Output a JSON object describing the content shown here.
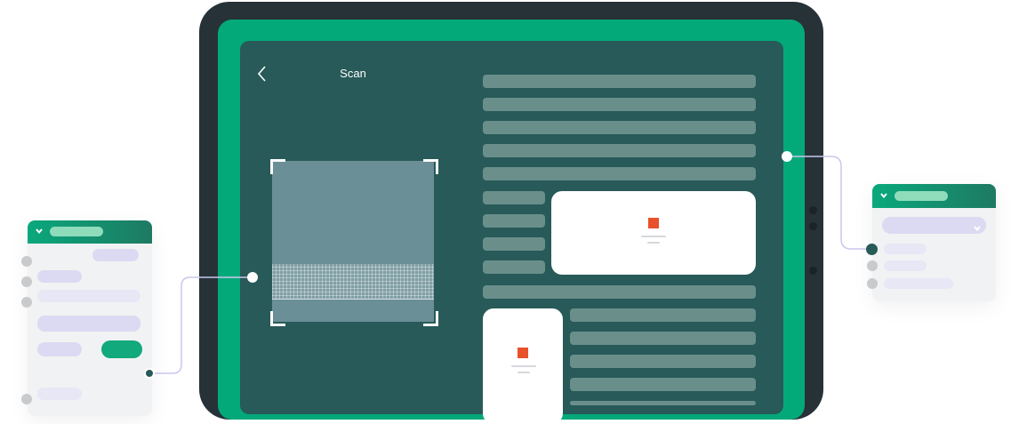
{
  "screen": {
    "title": "Scan",
    "back_icon": "chevron-left-icon"
  },
  "colors": {
    "device_frame": "#263238",
    "accent_green": "#04a97a",
    "screen_bg": "#275a58",
    "doc_bar": "#6a8f8b",
    "image_marker": "#e8512a",
    "panel_bg": "#f1f2f3",
    "lavender": "#dcdaf2"
  },
  "icons": {
    "dropdown": "chevron-down-icon",
    "image": "image-placeholder-icon"
  }
}
